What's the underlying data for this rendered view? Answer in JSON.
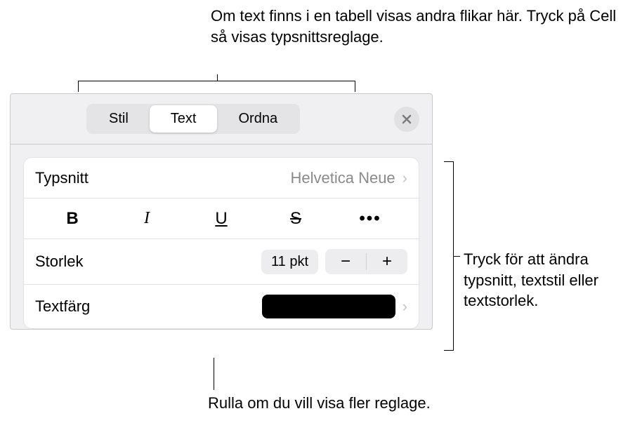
{
  "callouts": {
    "top": "Om text finns i en tabell visas andra flikar här. Tryck på Cell så visas typsnittsreglage.",
    "right": "Tryck för att ändra typsnitt, textstil eller textstorlek.",
    "bottom": "Rulla om du vill visa fler reglage."
  },
  "tabs": {
    "style": "Stil",
    "text": "Text",
    "arrange": "Ordna"
  },
  "font": {
    "label": "Typsnitt",
    "value": "Helvetica Neue"
  },
  "styles": {
    "bold": "B",
    "italic": "I",
    "underline": "U",
    "strike": "S",
    "more": "•••"
  },
  "size": {
    "label": "Storlek",
    "value": "11 pkt",
    "minus": "−",
    "plus": "+"
  },
  "textcolor": {
    "label": "Textfärg",
    "value": "#000000"
  },
  "icons": {
    "chevron": "›"
  }
}
